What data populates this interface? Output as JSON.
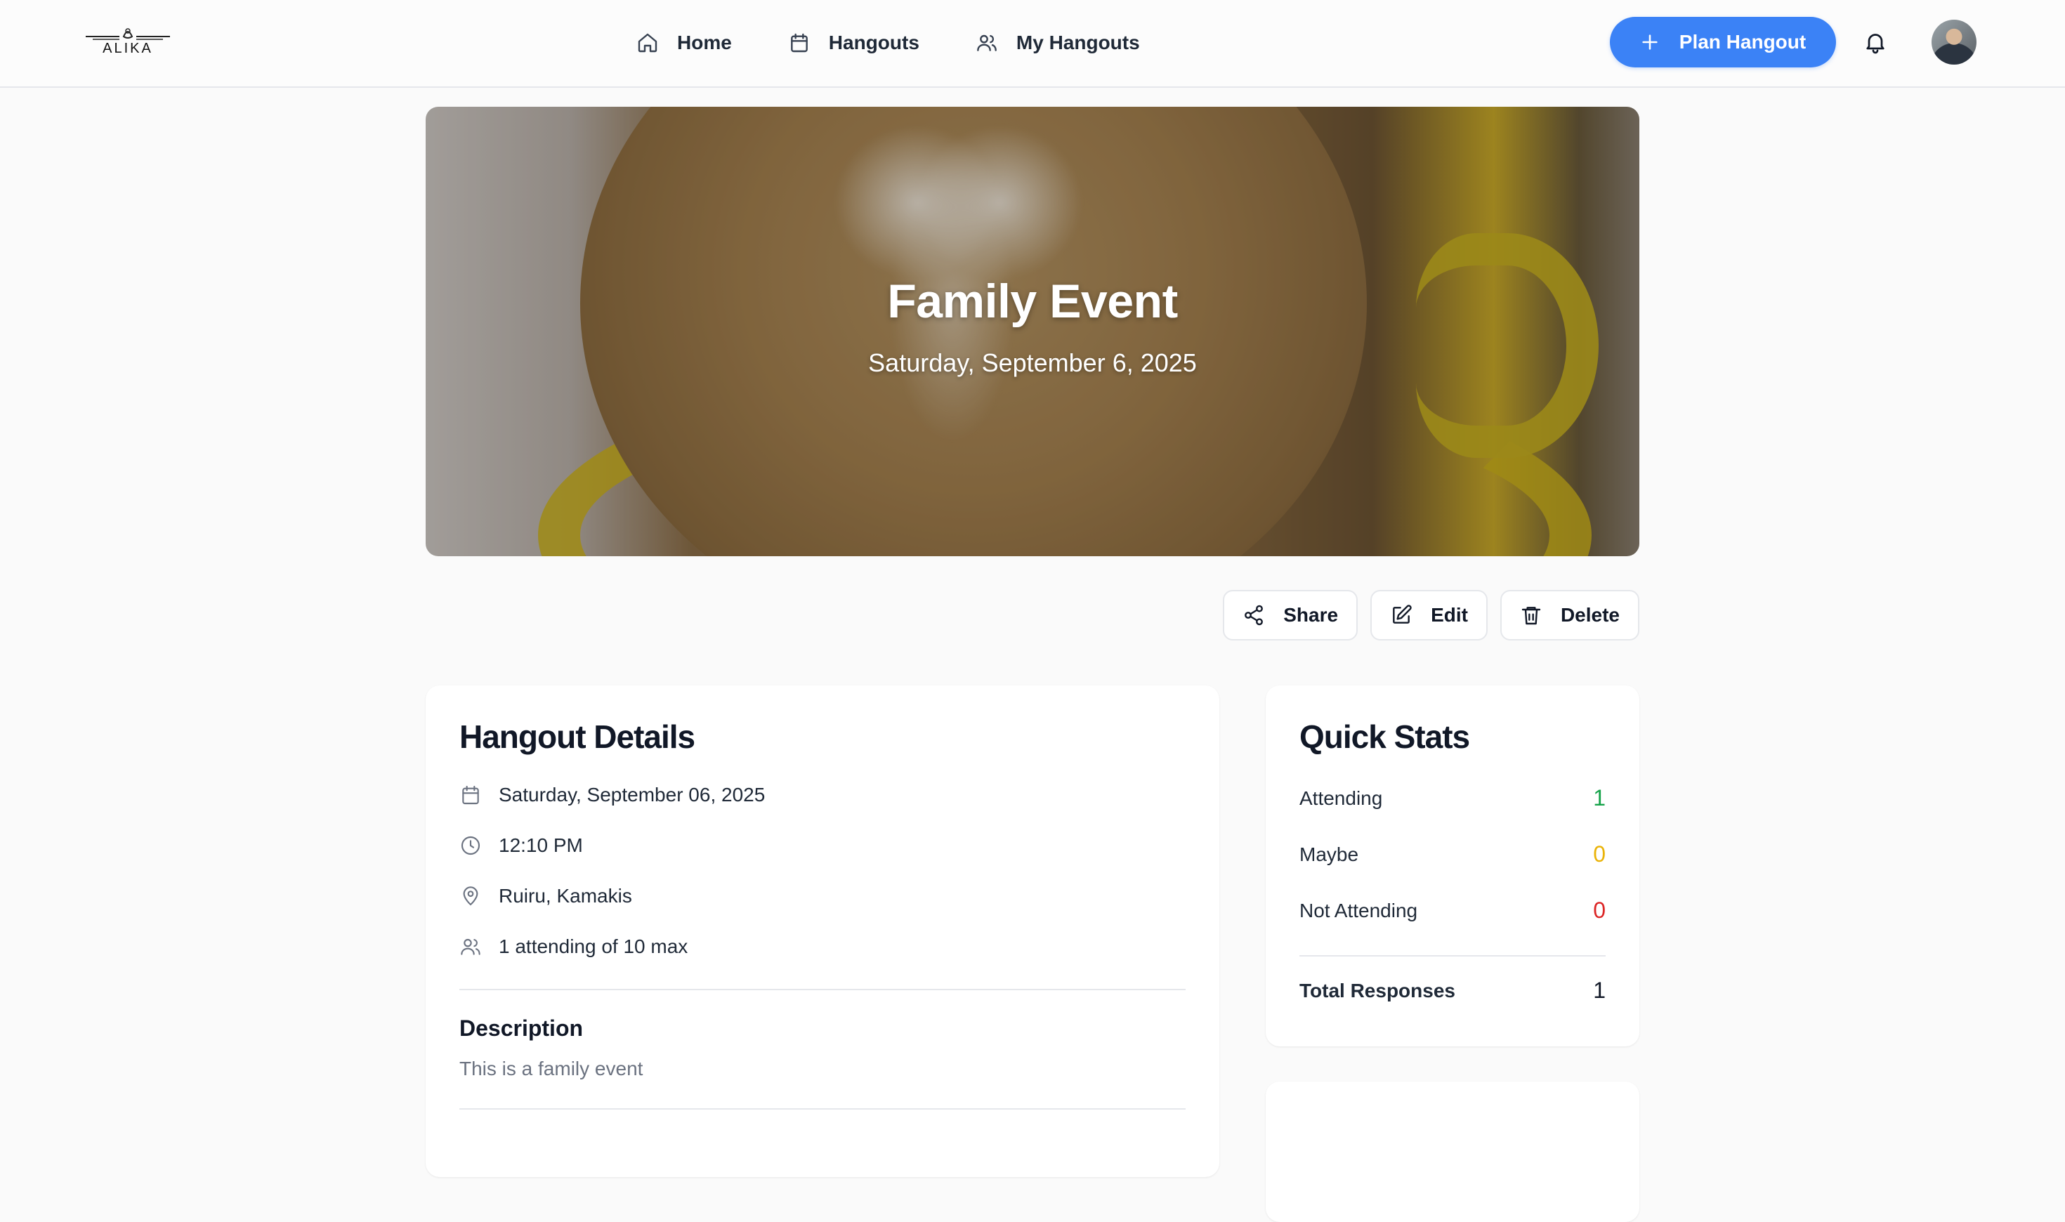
{
  "brand": {
    "logo_text": "ALIKA"
  },
  "nav": {
    "links": [
      {
        "label": "Home",
        "icon": "home-icon"
      },
      {
        "label": "Hangouts",
        "icon": "calendar-icon"
      },
      {
        "label": "My Hangouts",
        "icon": "users-icon"
      }
    ],
    "plan_button": "Plan Hangout",
    "accent": "#3b82f6"
  },
  "hero": {
    "title": "Family Event",
    "date": "Saturday, September 6, 2025"
  },
  "actions": {
    "share": "Share",
    "edit": "Edit",
    "delete": "Delete"
  },
  "details": {
    "title": "Hangout Details",
    "date": "Saturday, September 06, 2025",
    "time": "12:10 PM",
    "location": "Ruiru, Kamakis",
    "attendance": "1 attending of 10 max",
    "description_title": "Description",
    "description": "This is a family event"
  },
  "stats": {
    "title": "Quick Stats",
    "attending_label": "Attending",
    "attending_value": "1",
    "maybe_label": "Maybe",
    "maybe_value": "0",
    "not_attending_label": "Not Attending",
    "not_attending_value": "0",
    "total_label": "Total Responses",
    "total_value": "1",
    "colors": {
      "attending": "#16a34a",
      "maybe": "#eab308",
      "not_attending": "#dc2626"
    }
  }
}
